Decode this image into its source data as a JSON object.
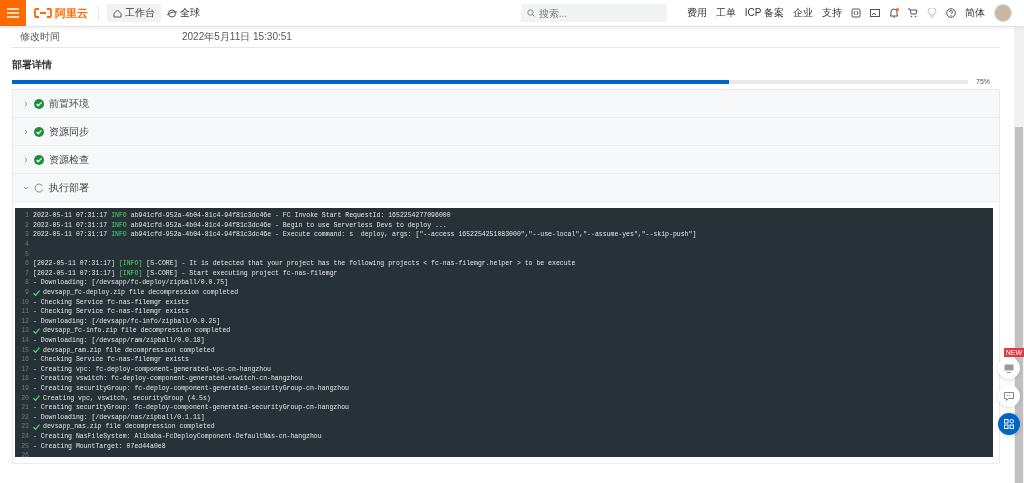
{
  "header": {
    "logo": "阿里云",
    "workbench": "工作台",
    "region": "全球",
    "search": {
      "placeholder": "搜索..."
    },
    "nav_links": [
      "费用",
      "工单",
      "ICP 备案",
      "企业",
      "支持"
    ],
    "notifications": true,
    "language": "简体"
  },
  "info": {
    "label": "修改时间",
    "value": "2022年5月11日 15:30:51"
  },
  "deploy": {
    "title": "部署详情",
    "progress": {
      "level": 0.75,
      "reading": "75%"
    },
    "steps": [
      {
        "label": "前置环境",
        "kind": "done",
        "expanded": false
      },
      {
        "label": "资源同步",
        "kind": "done",
        "expanded": false
      },
      {
        "label": "资源检查",
        "kind": "done",
        "expanded": false
      },
      {
        "label": "执行部署",
        "kind": "running",
        "expanded": true
      }
    ]
  },
  "log": [
    {
      "num": "1",
      "kind": "info",
      "time": "2022-05-11 07:31:17",
      "level": "INFO",
      "text": "ab941cfd-952a-4b04-81c4-94f81c3dc46e - FC Invoke Start RequestId: 1652254277096000"
    },
    {
      "num": "2",
      "kind": "info",
      "time": "2022-05-11 07:31:17",
      "level": "INFO",
      "text": "ab941cfd-952a-4b04-81c4-94f81c3dc46e - Begin to use Serverless Devs to deploy ..."
    },
    {
      "num": "3",
      "kind": "info",
      "time": "2022-05-11 07:31:17",
      "level": "INFO",
      "text": "ab941cfd-952a-4b04-81c4-94f81c3dc46e - Execute command: s  deploy, args: [\"--access 1652254251083000\",\"--use-local\",\"--assume-yes\",\"--skip-push\"]"
    },
    {
      "num": "4",
      "kind": "blank"
    },
    {
      "num": "5",
      "kind": "blank"
    },
    {
      "num": "6",
      "kind": "info",
      "time": "[2022-05-11 07:31:17]",
      "level": "[INFO]",
      "text": "[S-CORE] - It is detected that your project has the following projects < fc-nas-filemgr.helper > to be execute"
    },
    {
      "num": "7",
      "kind": "info",
      "time": "[2022-05-11 07:31:17]",
      "level": "[INFO]",
      "text": "[S-CORE] - Start executing project fc-nas-filemgr"
    },
    {
      "num": "8",
      "kind": "plain",
      "text": "- Downloading: [/devsapp/fc-deploy/zipball/0.0.75]"
    },
    {
      "num": "9",
      "kind": "success",
      "text": "devsapp_fc-deploy.zip file decompression completed"
    },
    {
      "num": "10",
      "kind": "plain",
      "text": "- Checking Service fc-nas-filemgr exists"
    },
    {
      "num": "11",
      "kind": "plain",
      "text": "- Checking Service fc-nas-filemgr exists"
    },
    {
      "num": "12",
      "kind": "plain",
      "text": "- Downloading: [/devsapp/fc-info/zipball/0.0.25]"
    },
    {
      "num": "13",
      "kind": "success",
      "text": "devsapp_fc-info.zip file decompression completed"
    },
    {
      "num": "14",
      "kind": "plain",
      "text": "- Downloading: [/devsapp/ram/zipball/0.0.18]"
    },
    {
      "num": "15",
      "kind": "success",
      "text": "devsapp_ram.zip file decompression completed"
    },
    {
      "num": "16",
      "kind": "plain",
      "text": "- Checking Service fc-nas-filemgr exists"
    },
    {
      "num": "17",
      "kind": "plain",
      "text": "- Creating vpc: fc-deploy-component-generated-vpc-cn-hangzhou"
    },
    {
      "num": "18",
      "kind": "plain",
      "text": "- Creating vswitch: fc-deploy-component-generated-vswitch-cn-hangzhou"
    },
    {
      "num": "19",
      "kind": "plain",
      "text": "- Creating securityGroup: fc-deploy-component-generated-securityGroup-cn-hangzhou"
    },
    {
      "num": "20",
      "kind": "success",
      "text": "Creating vpc, vswitch, securityGroup (4.5s)"
    },
    {
      "num": "21",
      "kind": "plain",
      "text": "- Creating securityGroup: fc-deploy-component-generated-securityGroup-cn-hangzhou"
    },
    {
      "num": "22",
      "kind": "plain",
      "text": "- Downloading: [/devsapp/nas/zipball/0.1.11]"
    },
    {
      "num": "23",
      "kind": "success",
      "text": "devsapp_nas.zip file decompression completed"
    },
    {
      "num": "24",
      "kind": "plain",
      "text": "- Creating NasFileSystem: Alibaba-FcDeployComponent-DefaultNas-cn-hangzhou"
    },
    {
      "num": "25",
      "kind": "plain",
      "text": "- Creating MountTarget: 07ed44a0e8"
    },
    {
      "num": "26",
      "kind": "blank"
    }
  ],
  "float_tools": {
    "badge": "NEW"
  }
}
